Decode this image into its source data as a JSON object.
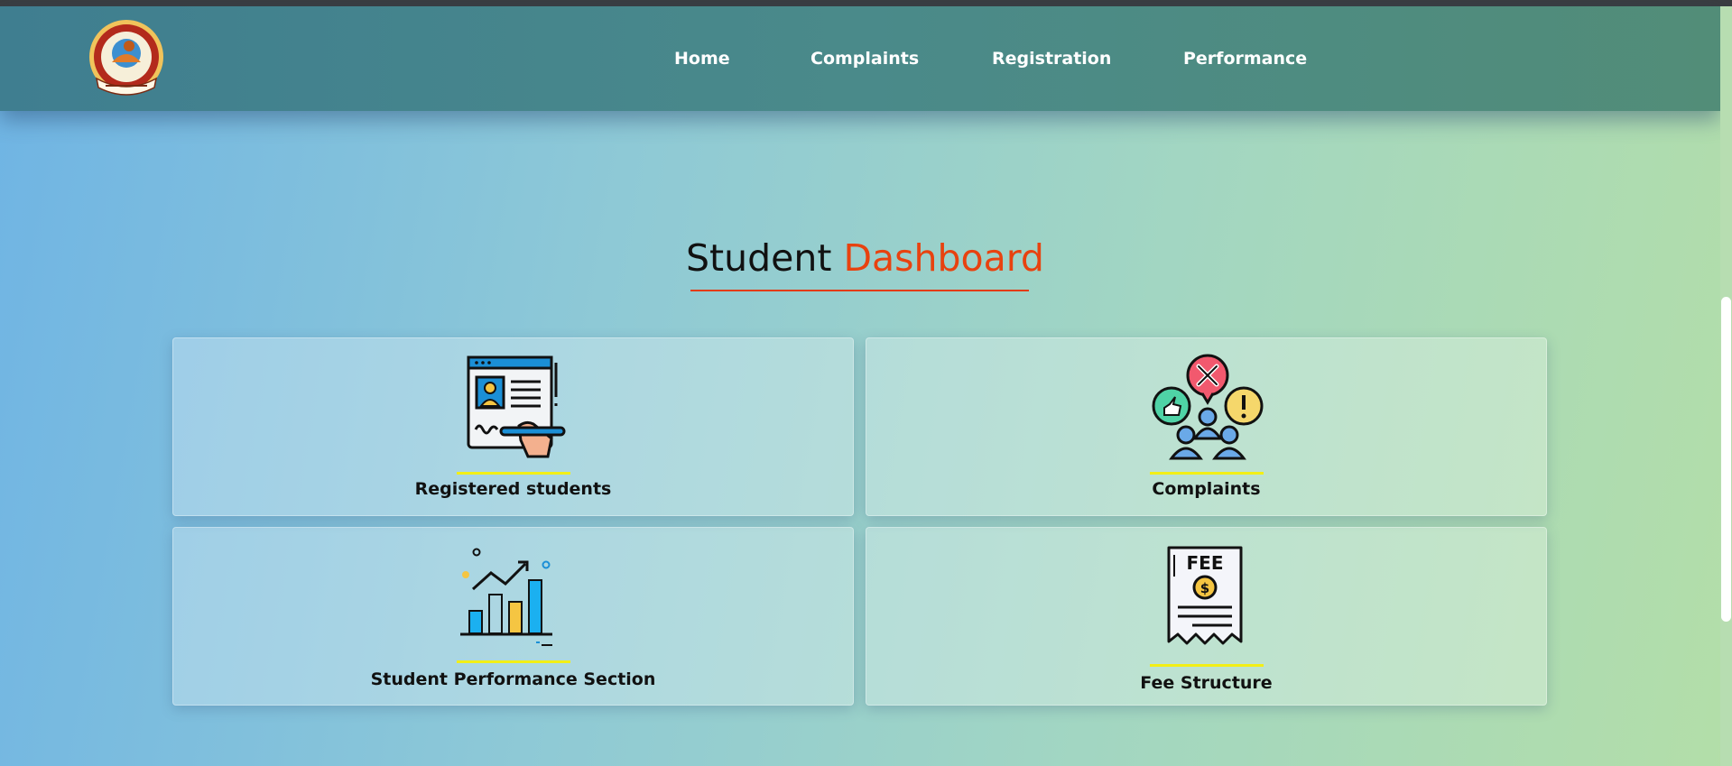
{
  "nav": {
    "links": [
      "Home",
      "Complaints",
      "Registration",
      "Performance"
    ]
  },
  "heading": {
    "part1": "Student",
    "part2": "Dashboard"
  },
  "cards": [
    {
      "label": "Registered students",
      "icon": "registration-form-icon"
    },
    {
      "label": "Complaints",
      "icon": "complaints-feedback-icon"
    },
    {
      "label": "Student Performance Section",
      "icon": "performance-chart-icon"
    },
    {
      "label": "Fee Structure",
      "icon": "fee-receipt-icon",
      "icon_text": "FEE",
      "currency_symbol": "$"
    }
  ],
  "colors": {
    "accent": "#e8420f",
    "underline_yellow": "#f2ef16",
    "nav_bg": "#4a8a8a"
  }
}
